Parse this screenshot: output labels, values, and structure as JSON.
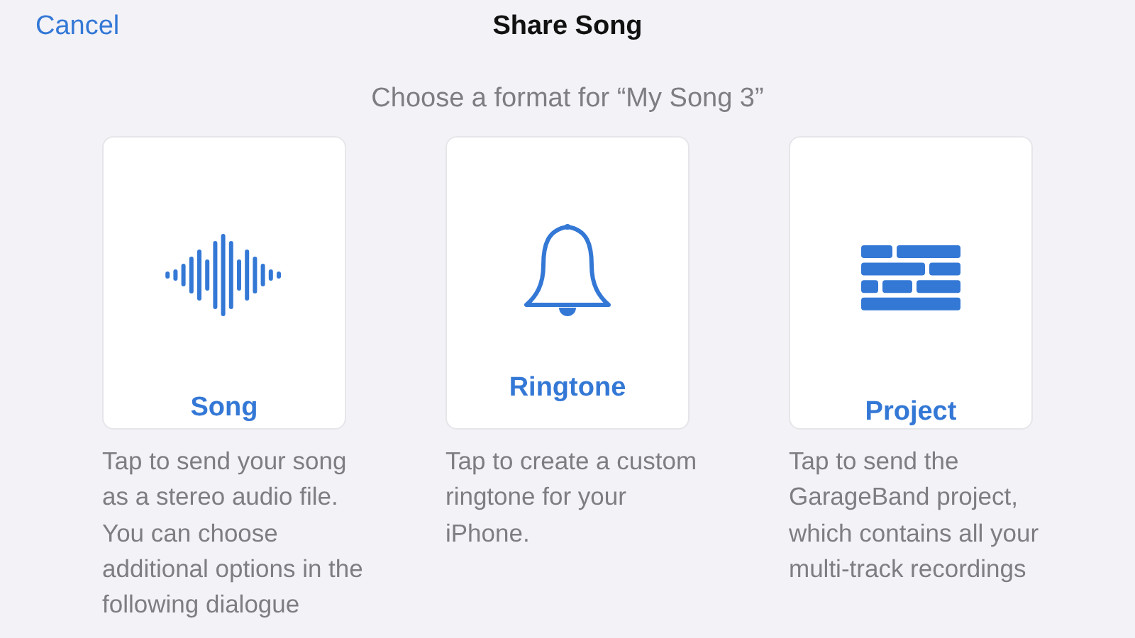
{
  "nav": {
    "cancel": "Cancel",
    "title": "Share Song"
  },
  "subtitle": "Choose a format for “My Song 3”",
  "formats": [
    {
      "kind": "song",
      "label": "Song",
      "description": "Tap to send your song as a stereo audio file. You can choose additional options in the following dialogue"
    },
    {
      "kind": "ringtone",
      "label": "Ringtone",
      "description": "Tap to create a custom ringtone for your iPhone."
    },
    {
      "kind": "project",
      "label": "Project",
      "description": "Tap to send the GarageBand project, which contains all your multi-track recordings"
    }
  ]
}
